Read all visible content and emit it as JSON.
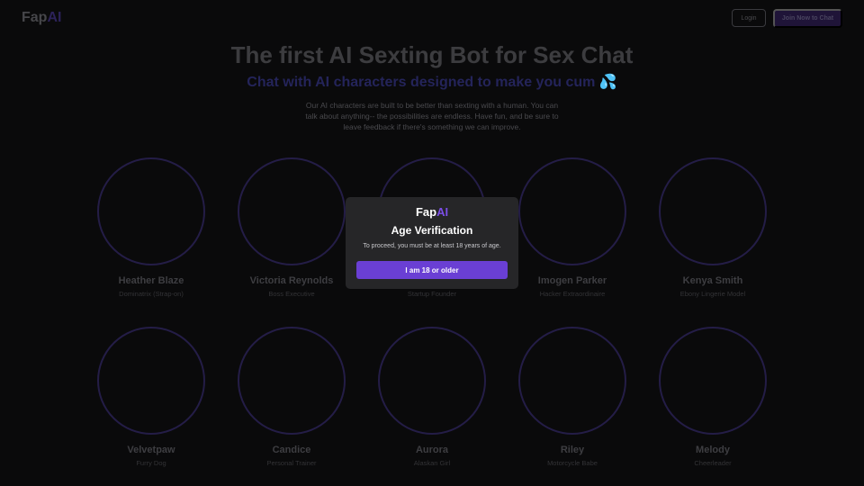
{
  "header": {
    "logo_main": "Fap",
    "logo_accent": "AI",
    "login_label": "Login",
    "join_label": "Join Now to Chat"
  },
  "hero": {
    "title": "The first AI Sexting Bot for Sex Chat",
    "subtitle": "Chat with AI characters designed to make you cum 💦",
    "description": "Our AI characters are built to be better than sexting with a human. You can talk about anything-- the possibilities are endless. Have fun, and be sure to leave feedback if there's something we can improve."
  },
  "characters": [
    {
      "name": "Heather Blaze",
      "role": "Dominatrix (Strap-on)"
    },
    {
      "name": "Victoria Reynolds",
      "role": "Boss Executive"
    },
    {
      "name": "",
      "role": "Startup Founder"
    },
    {
      "name": "Imogen Parker",
      "role": "Hacker Extraordinaire"
    },
    {
      "name": "Kenya Smith",
      "role": "Ebony Lingerie Model"
    },
    {
      "name": "Velvetpaw",
      "role": "Furry Dog"
    },
    {
      "name": "Candice",
      "role": "Personal Trainer"
    },
    {
      "name": "Aurora",
      "role": "Alaskan Girl"
    },
    {
      "name": "Riley",
      "role": "Motorcycle Babe"
    },
    {
      "name": "Melody",
      "role": "Cheerleader"
    }
  ],
  "modal": {
    "logo_main": "Fap",
    "logo_accent": "AI",
    "title": "Age Verification",
    "text": "To proceed, you must be at least 18 years of age.",
    "button_label": "I am 18 or older"
  },
  "colors": {
    "accent": "#6a3fd4",
    "background": "#0a0a0b",
    "modal_bg": "#262628"
  }
}
